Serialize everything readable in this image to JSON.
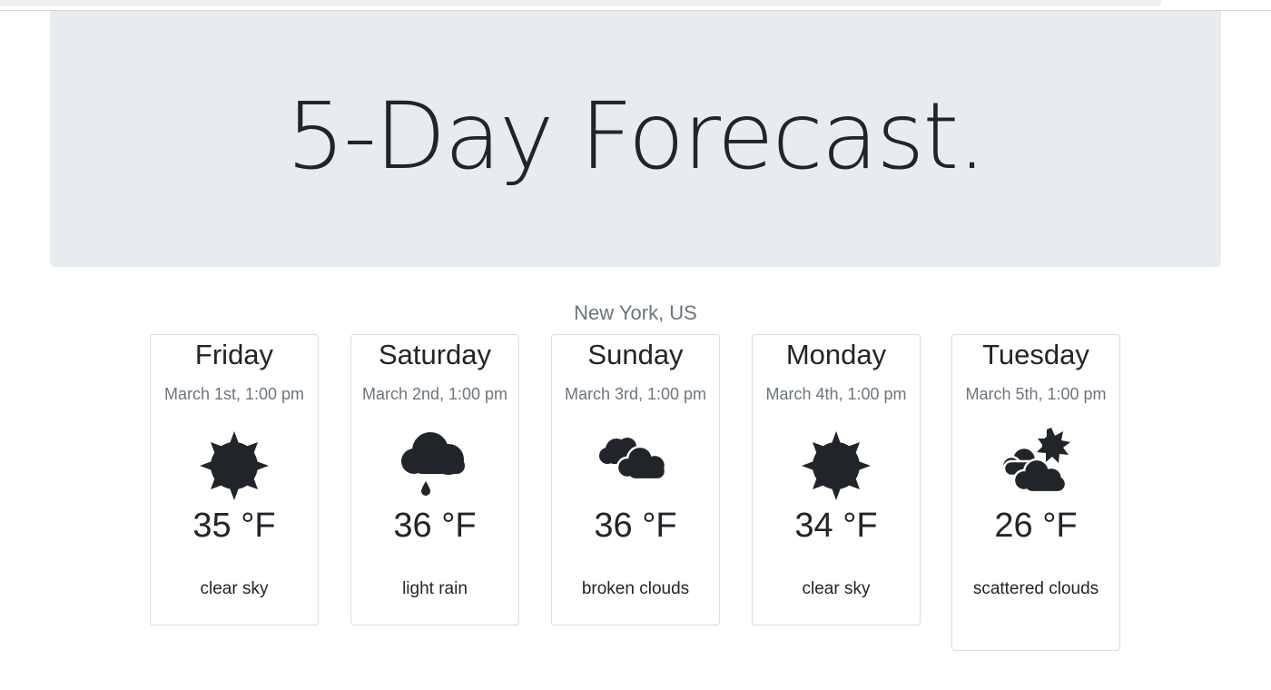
{
  "header": {
    "title": "5-Day Forecast."
  },
  "location": "New York, US",
  "forecast": [
    {
      "day": "Friday",
      "date": "March 1st, 1:00 pm",
      "icon": "sun-icon",
      "temp": "35 °F",
      "desc": "clear sky"
    },
    {
      "day": "Saturday",
      "date": "March 2nd, 1:00 pm",
      "icon": "rain-cloud-icon",
      "temp": "36 °F",
      "desc": "light rain"
    },
    {
      "day": "Sunday",
      "date": "March 3rd, 1:00 pm",
      "icon": "clouds-icon",
      "temp": "36 °F",
      "desc": "broken clouds"
    },
    {
      "day": "Monday",
      "date": "March 4th, 1:00 pm",
      "icon": "sun-icon",
      "temp": "34 °F",
      "desc": "clear sky"
    },
    {
      "day": "Tuesday",
      "date": "March 5th, 1:00 pm",
      "icon": "cloud-sun-icon",
      "temp": "26 °F",
      "desc": "scattered clouds"
    }
  ],
  "colors": {
    "text": "#212529",
    "muted": "#6c757d",
    "jumbotron": "#e9ecef",
    "card_border": "#dcdcdc"
  }
}
